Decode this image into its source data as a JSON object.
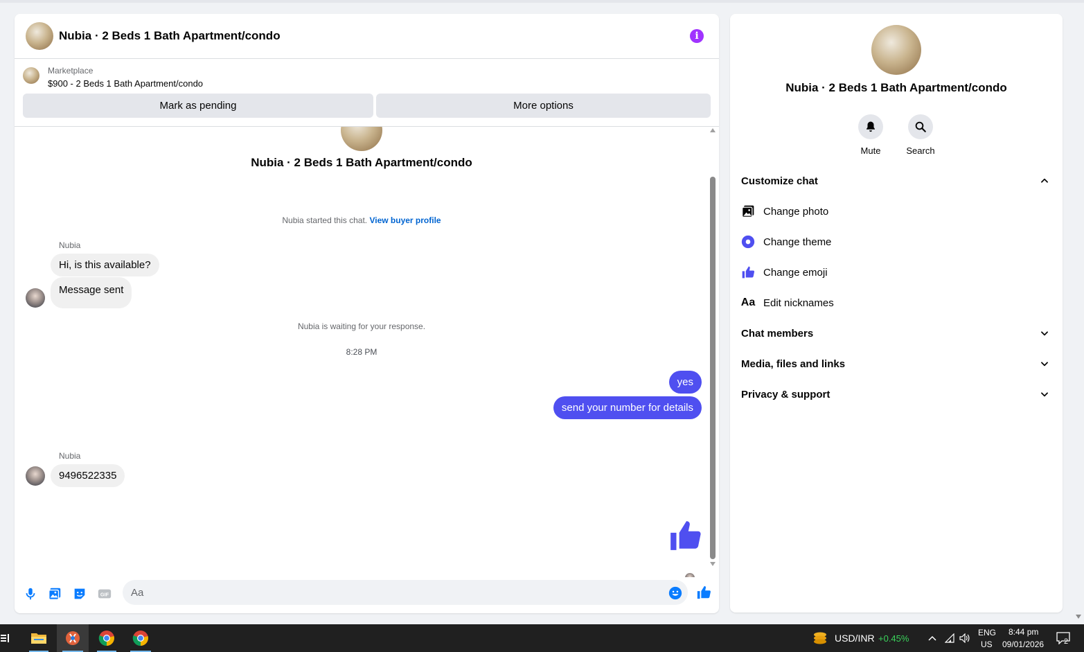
{
  "chat": {
    "title": "Nubia · 2 Beds 1 Bath Apartment/condo",
    "marketplace_label": "Marketplace",
    "listing": "$900 - 2 Beds 1 Bath Apartment/condo",
    "mark_pending_label": "Mark as pending",
    "more_options_label": "More options",
    "conversation_title": "Nubia · 2 Beds 1 Bath Apartment/condo",
    "started_text": "Nubia started this chat.",
    "view_buyer_profile": "View buyer profile",
    "waiting_text": "Nubia is waiting for your response.",
    "timestamp": "8:28 PM",
    "messages": [
      {
        "sender": "Nubia",
        "text": "Hi, is this available?",
        "direction": "in"
      },
      {
        "text": "Message sent",
        "direction": "in"
      },
      {
        "text": "yes",
        "direction": "out"
      },
      {
        "text": "send your number for details",
        "direction": "out"
      },
      {
        "sender": "Nubia",
        "text": "9496522335",
        "direction": "in"
      }
    ],
    "input_placeholder": "Aa",
    "accent_color": "#4f4ff0"
  },
  "info_panel": {
    "title": "Nubia · 2 Beds 1 Bath Apartment/condo",
    "actions": [
      {
        "label": "Mute",
        "icon": "bell-icon"
      },
      {
        "label": "Search",
        "icon": "search-icon"
      }
    ],
    "customize_chat": "Customize chat",
    "options": [
      {
        "label": "Change photo",
        "icon": "photo-icon"
      },
      {
        "label": "Change theme",
        "icon": "theme-icon"
      },
      {
        "label": "Change emoji",
        "icon": "thumbs-up-icon"
      },
      {
        "label": "Edit nicknames",
        "icon": "text-aa-icon"
      }
    ],
    "sections": [
      "Chat members",
      "Media, files and links",
      "Privacy & support"
    ]
  },
  "taskbar": {
    "ticker": "USD/INR",
    "ticker_change": "+0.45%",
    "lang_top": "ENG",
    "lang_bottom": "US",
    "time": "8:44 pm",
    "date": "09/01/2026",
    "notification_count": "2"
  }
}
